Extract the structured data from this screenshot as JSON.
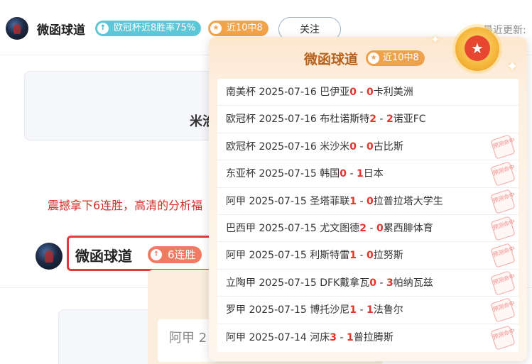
{
  "header": {
    "author_name": "微函球道",
    "win_badge": "欧冠杯近8胜率75%",
    "streak_badge": "近10中8",
    "follow_label": "关注",
    "last_update_label": "最近更新:"
  },
  "background": {
    "card_text": "米治",
    "promo_text": "震撼拿下6连胜，高清的分析福",
    "author_name": "微函球道",
    "streak_tag": "6连胜",
    "lower_card_text": "阿甲 2"
  },
  "popup": {
    "title": "微函球道",
    "tag": "近10中8",
    "stamp_text": "预测命中",
    "matches": [
      {
        "league": "南美杯",
        "date": "2025-07-16",
        "home": "巴伊亚",
        "hs": "0",
        "as": "0",
        "away": "卡利美洲",
        "hit": false
      },
      {
        "league": "欧冠杯",
        "date": "2025-07-16",
        "home": "布杜诺斯特",
        "hs": "2",
        "as": "2",
        "away": "诺亚FC",
        "hit": false
      },
      {
        "league": "欧冠杯",
        "date": "2025-07-16",
        "home": "米沙米",
        "hs": "0",
        "as": "0",
        "away": "古比斯",
        "hit": true
      },
      {
        "league": "东亚杯",
        "date": "2025-07-15",
        "home": "韩国",
        "hs": "0",
        "as": "1",
        "away": "日本",
        "hit": true
      },
      {
        "league": "阿甲",
        "date": "2025-07-15",
        "home": "圣塔菲联",
        "hs": "1",
        "as": "0",
        "away": "拉普拉塔大学生",
        "hit": true
      },
      {
        "league": "巴西甲",
        "date": "2025-07-15",
        "home": "尤文图德",
        "hs": "2",
        "as": "0",
        "away": "累西腓体育",
        "hit": true
      },
      {
        "league": "阿甲",
        "date": "2025-07-15",
        "home": "利斯特雷",
        "hs": "1",
        "as": "0",
        "away": "拉努斯",
        "hit": true
      },
      {
        "league": "立陶甲",
        "date": "2025-07-15",
        "home": "DFK戴拿瓦",
        "hs": "0",
        "as": "3",
        "away": "帕纳瓦兹",
        "hit": true
      },
      {
        "league": "罗甲",
        "date": "2025-07-15",
        "home": "博托沙尼",
        "hs": "1",
        "as": "1",
        "away": "法鲁尔",
        "hit": true
      },
      {
        "league": "阿甲",
        "date": "2025-07-14",
        "home": "河床",
        "hs": "3",
        "as": "1",
        "away": "普拉腾斯",
        "hit": true
      }
    ]
  },
  "colors": {
    "accent_red": "#e2342b",
    "badge_cyan": "#5cc7d6",
    "badge_orange": "#f3a44a",
    "highlight_border": "#e5393c"
  }
}
